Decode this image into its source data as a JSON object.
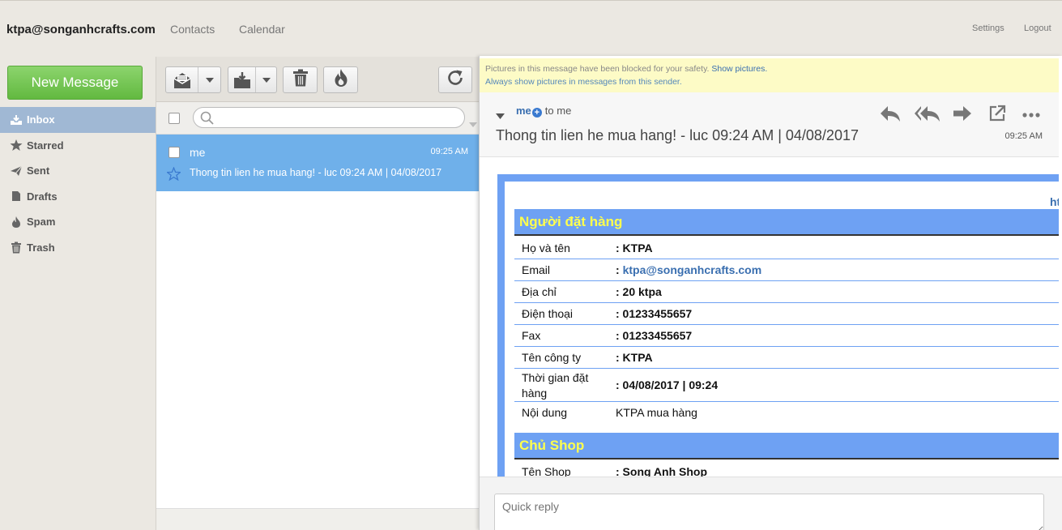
{
  "header": {
    "account": "ktpa@songanhcrafts.com",
    "nav": [
      "Contacts",
      "Calendar"
    ],
    "settings": "Settings",
    "logout": "Logout"
  },
  "sidebar": {
    "new_message": "New Message",
    "folders": [
      {
        "label": "Inbox",
        "icon": "inbox-icon",
        "active": true
      },
      {
        "label": "Starred",
        "icon": "star-icon"
      },
      {
        "label": "Sent",
        "icon": "send-icon"
      },
      {
        "label": "Drafts",
        "icon": "drafts-icon"
      },
      {
        "label": "Spam",
        "icon": "fire-icon"
      },
      {
        "label": "Trash",
        "icon": "trash-icon"
      }
    ]
  },
  "list": {
    "search_placeholder": "",
    "messages": [
      {
        "from": "me",
        "time": "09:25 AM",
        "subject": "Thong tin lien he mua hang! - luc 09:24 AM | 04/08/2017",
        "selected": true
      }
    ]
  },
  "reader": {
    "image_warning": "Pictures in this message have been blocked for your safety.",
    "show_pictures": "Show pictures.",
    "always_show": "Always show pictures in messages from this sender.",
    "sender": "me",
    "to": "to me",
    "subject": "Thong tin lien he mua hang! - luc 09:24 AM | 04/08/2017",
    "time": "09:25 AM",
    "quick_reply_placeholder": "Quick reply",
    "email": {
      "link_fragment": "htt",
      "buyer_heading": "Người đặt hàng",
      "rows": [
        {
          "label": "Họ và tên",
          "value": ": KTPA"
        },
        {
          "label": "Email",
          "prefix": ": ",
          "value": "ktpa@songanhcrafts.com"
        },
        {
          "label": "Địa chỉ",
          "value": ": 20 ktpa"
        },
        {
          "label": "Điện thoại",
          "value": ": 01233455657"
        },
        {
          "label": "Fax",
          "value": ": 01233455657"
        },
        {
          "label": "Tên công ty",
          "value": ": KTPA"
        },
        {
          "label": "Thời gian đặt hàng",
          "value": ": 04/08/2017 | 09:24"
        },
        {
          "label": "Nội dung",
          "value": "KTPA mua hàng"
        }
      ],
      "shop_heading": "Chủ Shop",
      "shop_rows": [
        {
          "label": "Tên Shop",
          "value": ": Song Anh Shop"
        }
      ]
    }
  },
  "colors": {
    "accent": "#6fb0ea",
    "email_blue": "#6ea1f3",
    "heading_yellow": "#ffff4d",
    "new_message_green": "#62b940"
  }
}
